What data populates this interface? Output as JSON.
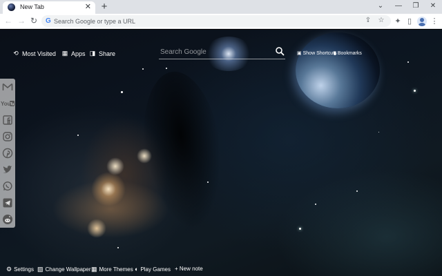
{
  "browser": {
    "tab": {
      "title": "New Tab",
      "close_icon": "close-icon"
    },
    "new_tab_label": "+",
    "window_controls": [
      "minimize-icon",
      "restore-icon",
      "close-icon"
    ],
    "omnibox": {
      "placeholder": "Search Google or type a URL"
    }
  },
  "page": {
    "top_nav": {
      "most_visited": "Most Visited",
      "apps": "Apps",
      "share": "Share"
    },
    "search": {
      "placeholder": "Search Google"
    },
    "right_nav": {
      "show_shortcuts": "Show Shortcuts",
      "bookmarks": "Bookmarks"
    },
    "social": [
      {
        "name": "gmail-icon",
        "label": "M"
      },
      {
        "name": "youtube-icon",
        "label": "You"
      },
      {
        "name": "facebook-icon",
        "label": "f"
      },
      {
        "name": "instagram-icon",
        "label": "◎"
      },
      {
        "name": "pinterest-icon",
        "label": "P"
      },
      {
        "name": "twitter-icon",
        "label": "t"
      },
      {
        "name": "whatsapp-icon",
        "label": "w"
      },
      {
        "name": "telegram-icon",
        "label": "➤"
      },
      {
        "name": "reddit-icon",
        "label": "r"
      }
    ],
    "bottom_nav": {
      "settings": "Settings",
      "change_wallpaper": "Change Wallpaper",
      "more_themes": "More Themes",
      "play_games": "Play Games",
      "new_note": "+ New note"
    }
  },
  "colors": {
    "accent": "#4285f4",
    "chrome_frame": "#dee1e6",
    "toolbar": "#ffffff",
    "page_text": "#ffffff"
  }
}
